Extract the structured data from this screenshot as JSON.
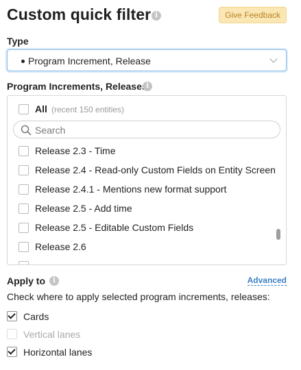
{
  "header": {
    "title": "Custom quick filter",
    "feedback_label": "Give Feedback"
  },
  "type": {
    "label": "Type",
    "value": "Program Increment, Release"
  },
  "entities": {
    "label": "Program Increments, Releases",
    "all_label": "All",
    "all_note": "(recent 150 entities)",
    "search_placeholder": "Search",
    "items": [
      {
        "label": "Release 2.3 - Time",
        "checked": false
      },
      {
        "label": "Release 2.4 - Read-only Custom Fields on Entity Screen",
        "checked": false
      },
      {
        "label": "Release 2.4.1 - Mentions new format support",
        "checked": false
      },
      {
        "label": "Release 2.5 - Add time",
        "checked": false
      },
      {
        "label": "Release 2.5 - Editable Custom Fields",
        "checked": false
      },
      {
        "label": "Release 2.6",
        "checked": false
      }
    ]
  },
  "apply": {
    "label": "Apply to",
    "advanced_label": "Advanced",
    "description": "Check where to apply selected program increments, releases:",
    "options": [
      {
        "label": "Cards",
        "checked": true,
        "disabled": false
      },
      {
        "label": "Vertical lanes",
        "checked": false,
        "disabled": true
      },
      {
        "label": "Horizontal lanes",
        "checked": true,
        "disabled": false
      }
    ]
  },
  "icons": {
    "info": "info-icon",
    "search": "search-icon",
    "chevron": "chevron-down-icon",
    "check": "check-icon"
  },
  "colors": {
    "feedback_bg": "#fbe7b3",
    "feedback_text": "#b8832a",
    "link": "#3c80c8",
    "select_border": "#8dbce8"
  }
}
